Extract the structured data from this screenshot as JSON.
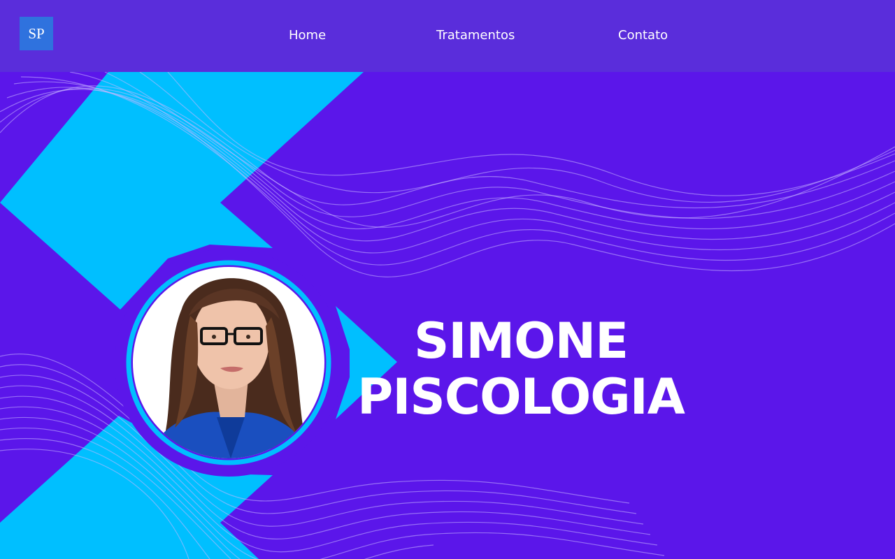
{
  "navbar": {
    "logo": "SP",
    "links": [
      "Home",
      "Tratamentos",
      "Contato"
    ]
  },
  "hero": {
    "title_line1": "SIMONE",
    "title_line2": "PISCOLOGIA",
    "portrait_alt": "Foto de Simone"
  },
  "colors": {
    "background": "#5b16ea",
    "navbar": "#5a2ddb",
    "accent": "#00bfff",
    "logo_bg": "#2f72de",
    "text": "#ffffff"
  }
}
